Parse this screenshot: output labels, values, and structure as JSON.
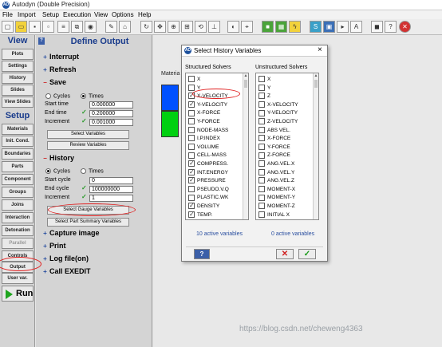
{
  "app": {
    "title": "Autodyn (Double Precision)",
    "logo": "AD"
  },
  "menu": [
    "File",
    "Import",
    "Setup",
    "Execution",
    "View",
    "Options",
    "Help"
  ],
  "nav": {
    "view_header": "View",
    "view_items": [
      "Plots",
      "Settings",
      "History",
      "Slides",
      "View Slides"
    ],
    "setup_header": "Setup",
    "setup_items": [
      "Materials",
      "Init. Cond.",
      "Boundaries",
      "Parts",
      "Component",
      "Groups",
      "Joins",
      "Interaction",
      "Detonation",
      "Parallel",
      "Controls",
      "Output",
      "User var."
    ],
    "run_label": "Run"
  },
  "panel": {
    "help": "?",
    "title": "Define Output",
    "interrupt": "Interrupt",
    "refresh": "Refresh",
    "save": {
      "title": "Save",
      "cycles": "Cycles",
      "times": "Times",
      "start_time_label": "Start time",
      "start_time": "0.000000",
      "end_time_label": "End time",
      "end_time": "0.200000",
      "increment_label": "Increment",
      "increment": "0.001000",
      "select_variables": "Select Variables",
      "review_variables": "Review Variables"
    },
    "history": {
      "title": "History",
      "cycles": "Cycles",
      "times": "Times",
      "start_cycle_label": "Start cycle",
      "start_cycle": "0",
      "end_cycle_label": "End cycle",
      "end_cycle": "100000000",
      "increment_label": "Increment",
      "increment": "1",
      "select_gauge": "Select Gauge Variables",
      "select_part_summary": "Select Part Summary Variables"
    },
    "capture_image": "Capture image",
    "print": "Print",
    "log_file": "Log file(on)",
    "call_exedit": "Call EXEDIT"
  },
  "canvas": {
    "material_label": "Materia",
    "watermark": "https://blog.csdn.net/cheweng4363"
  },
  "dialog": {
    "title": "Select History Variables",
    "close": "×",
    "structured_header": "Structured Solvers",
    "unstructured_header": "Unstructured Solvers",
    "structured": [
      {
        "label": "X",
        "checked": false
      },
      {
        "label": "Y",
        "checked": false
      },
      {
        "label": "X-VELOCITY",
        "checked": true
      },
      {
        "label": "Y-VELOCITY",
        "checked": true
      },
      {
        "label": "X-FORCE",
        "checked": false
      },
      {
        "label": "Y-FORCE",
        "checked": false
      },
      {
        "label": "NODE-MASS",
        "checked": false
      },
      {
        "label": "I.P.INDEX",
        "checked": false
      },
      {
        "label": "VOLUME",
        "checked": false
      },
      {
        "label": "CELL-MASS",
        "checked": false
      },
      {
        "label": "COMPRESS.",
        "checked": true
      },
      {
        "label": "INT.ENERGY",
        "checked": true
      },
      {
        "label": "PRESSURE",
        "checked": true
      },
      {
        "label": "PSEUDO.V.Q",
        "checked": false
      },
      {
        "label": "PLASTIC.WK",
        "checked": false
      },
      {
        "label": "DENSITY",
        "checked": true
      },
      {
        "label": "TEMP.",
        "checked": true
      }
    ],
    "unstructured": [
      {
        "label": "X",
        "checked": false
      },
      {
        "label": "Y",
        "checked": false
      },
      {
        "label": "Z",
        "checked": false
      },
      {
        "label": "X-VELOCITY",
        "checked": false
      },
      {
        "label": "Y-VELOCITY",
        "checked": false
      },
      {
        "label": "Z-VELOCITY",
        "checked": false
      },
      {
        "label": "ABS VEL.",
        "checked": false
      },
      {
        "label": "X-FORCE",
        "checked": false
      },
      {
        "label": "Y-FORCE",
        "checked": false
      },
      {
        "label": "Z-FORCE",
        "checked": false
      },
      {
        "label": "ANG.VEL.X",
        "checked": false
      },
      {
        "label": "ANG.VEL.Y",
        "checked": false
      },
      {
        "label": "ANG.VEL.Z",
        "checked": false
      },
      {
        "label": "MOMENT-X",
        "checked": false
      },
      {
        "label": "MOMENT-Y",
        "checked": false
      },
      {
        "label": "MOMENT-Z",
        "checked": false
      },
      {
        "label": "INITIAL X",
        "checked": false
      }
    ],
    "structured_count": "10 active variables",
    "unstructured_count": "0 active variables",
    "help": "?",
    "cancel": "✕",
    "ok": "✓"
  },
  "toolbar_icons": [
    "new-file-icon",
    "open-file-icon",
    "save-icon",
    "save-as-icon",
    "print-icon",
    "copy-icon",
    "refresh-icon",
    "redraw-icon",
    "pan-icon",
    "zoom-icon",
    "zoom-fit-icon",
    "rotate-icon",
    "axis-icon",
    "measure-icon",
    "eye-icon",
    "camera-icon",
    "cube-icon",
    "grid-icon",
    "lightning-icon",
    "select-icon",
    "s-icon",
    "next-icon",
    "text-icon",
    "stop-icon",
    "help-icon",
    "close-icon"
  ],
  "colors": {
    "material_1": "#0050ff",
    "material_2": "#00d010",
    "nav_header": "#1a3c8c",
    "annotation": "#e02020"
  }
}
